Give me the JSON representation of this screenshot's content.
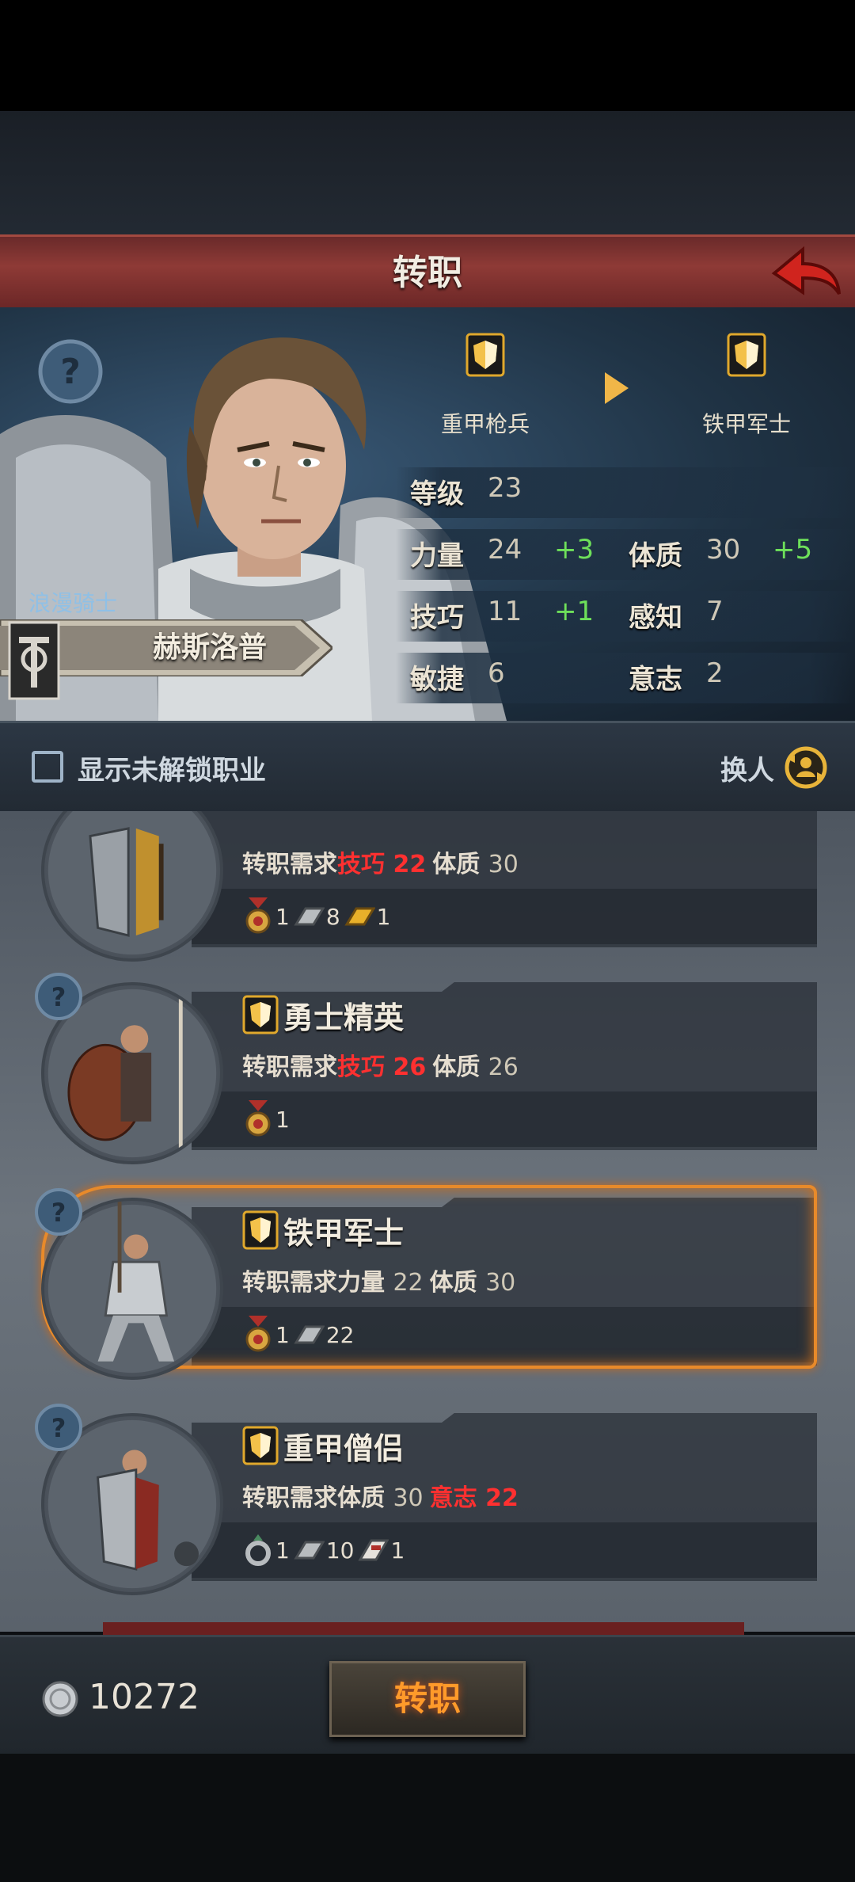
{
  "header": {
    "title": "转职"
  },
  "hero": {
    "class_label": "浪漫骑士",
    "name": "赫斯洛普",
    "current_class": "重甲枪兵",
    "target_class": "铁甲军士",
    "stats": {
      "level": {
        "label": "等级",
        "value": "23"
      },
      "strength": {
        "label": "力量",
        "value": "24",
        "bonus": "+3"
      },
      "constitution": {
        "label": "体质",
        "value": "30",
        "bonus": "+5"
      },
      "skill": {
        "label": "技巧",
        "value": "11",
        "bonus": "+1"
      },
      "perception": {
        "label": "感知",
        "value": "7"
      },
      "agility": {
        "label": "敏捷",
        "value": "6"
      },
      "will": {
        "label": "意志",
        "value": "2"
      }
    }
  },
  "filter": {
    "show_locked_label": "显示未解锁职业",
    "swap_label": "换人"
  },
  "classes": [
    {
      "name": "",
      "req_prefix": "转职需求",
      "req": [
        {
          "stat": "技巧",
          "value": "22",
          "met": false
        },
        {
          "stat": "体质",
          "value": "30",
          "met": true
        }
      ],
      "items": [
        {
          "icon": "medal-icon",
          "count": "1"
        },
        {
          "icon": "iron-ingot-icon",
          "count": "8"
        },
        {
          "icon": "gold-ingot-icon",
          "count": "1"
        }
      ]
    },
    {
      "name": "勇士精英",
      "req_prefix": "转职需求",
      "req": [
        {
          "stat": "技巧",
          "value": "26",
          "met": false
        },
        {
          "stat": "体质",
          "value": "26",
          "met": true
        }
      ],
      "items": [
        {
          "icon": "medal-icon",
          "count": "1"
        }
      ]
    },
    {
      "name": "铁甲军士",
      "req_prefix": "转职需求",
      "req": [
        {
          "stat": "力量",
          "value": "22",
          "met": true
        },
        {
          "stat": "体质",
          "value": "30",
          "met": true
        }
      ],
      "items": [
        {
          "icon": "medal-icon",
          "count": "1"
        },
        {
          "icon": "iron-ingot-icon",
          "count": "22"
        }
      ],
      "selected": true
    },
    {
      "name": "重甲僧侣",
      "req_prefix": "转职需求",
      "req": [
        {
          "stat": "体质",
          "value": "30",
          "met": true
        },
        {
          "stat": "意志",
          "value": "22",
          "met": false
        }
      ],
      "items": [
        {
          "icon": "ring-icon",
          "count": "1"
        },
        {
          "icon": "iron-ingot-icon",
          "count": "10"
        },
        {
          "icon": "scroll-icon",
          "count": "1"
        }
      ]
    }
  ],
  "footer": {
    "coins": "10272",
    "confirm_label": "转职"
  },
  "colors": {
    "accent_orange": "#e88a2a",
    "bonus_green": "#6ee05a",
    "unmet_red": "#ff3030",
    "header_red": "#8e3a36"
  }
}
